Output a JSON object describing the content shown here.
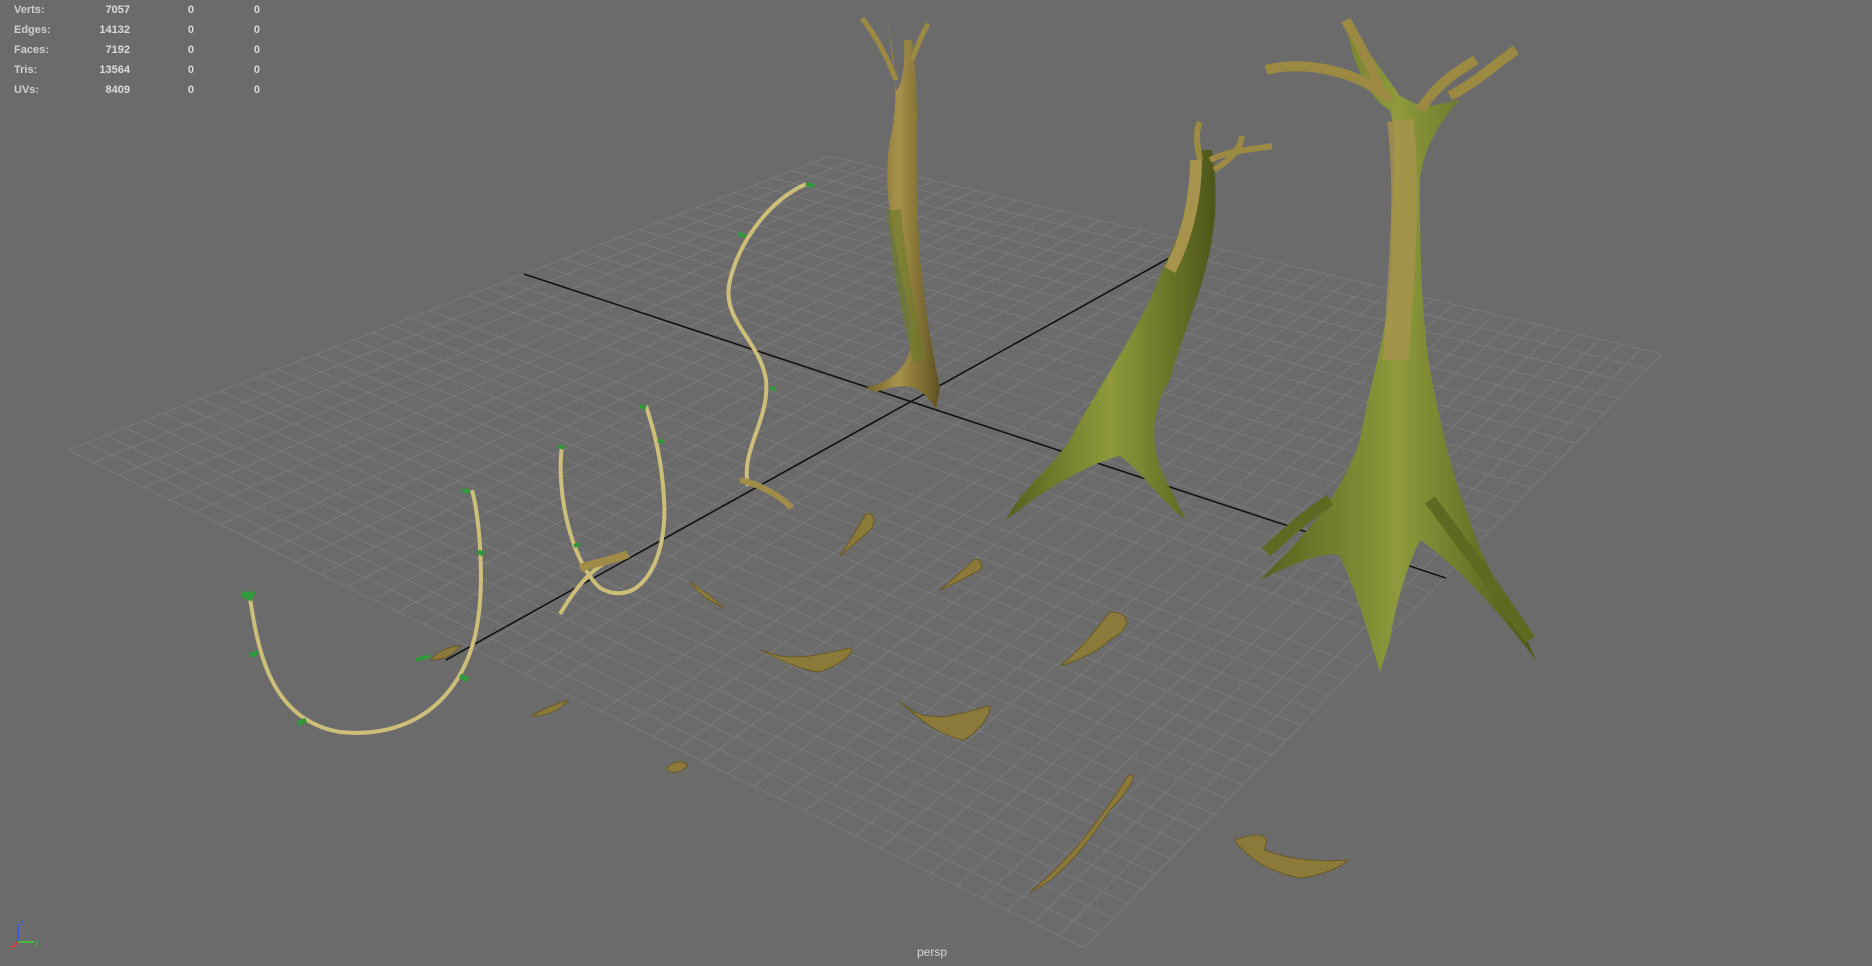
{
  "hud": {
    "rows": [
      {
        "label": "Verts:",
        "values": [
          "7057",
          "0",
          "0"
        ]
      },
      {
        "label": "Edges:",
        "values": [
          "14132",
          "0",
          "0"
        ]
      },
      {
        "label": "Faces:",
        "values": [
          "7192",
          "0",
          "0"
        ]
      },
      {
        "label": "Tris:",
        "values": [
          "13564",
          "0",
          "0"
        ]
      },
      {
        "label": "UVs:",
        "values": [
          "8409",
          "0",
          "0"
        ]
      }
    ]
  },
  "viewport": {
    "camera": "persp",
    "axis_labels": {
      "z": "z",
      "y": "y",
      "x": "x"
    }
  },
  "colors": {
    "background": "#6b6b6b",
    "grid": "#7d7d7d",
    "axis": "#111111",
    "bark": "#8c7a3a",
    "moss": "#6f7a2c",
    "vine": "#cdbf7a",
    "leaf": "#2f9a3a"
  },
  "scene_objects": [
    "trunk-large",
    "trunk-medium",
    "trunk-thin",
    "vine-1",
    "vine-2",
    "vine-3",
    "vine-4",
    "root-fragment-1",
    "root-fragment-2",
    "root-fragment-3",
    "root-fragment-4",
    "root-fragment-5",
    "root-fragment-6",
    "root-fragment-7",
    "root-fragment-8",
    "root-fragment-9",
    "root-fragment-10"
  ]
}
